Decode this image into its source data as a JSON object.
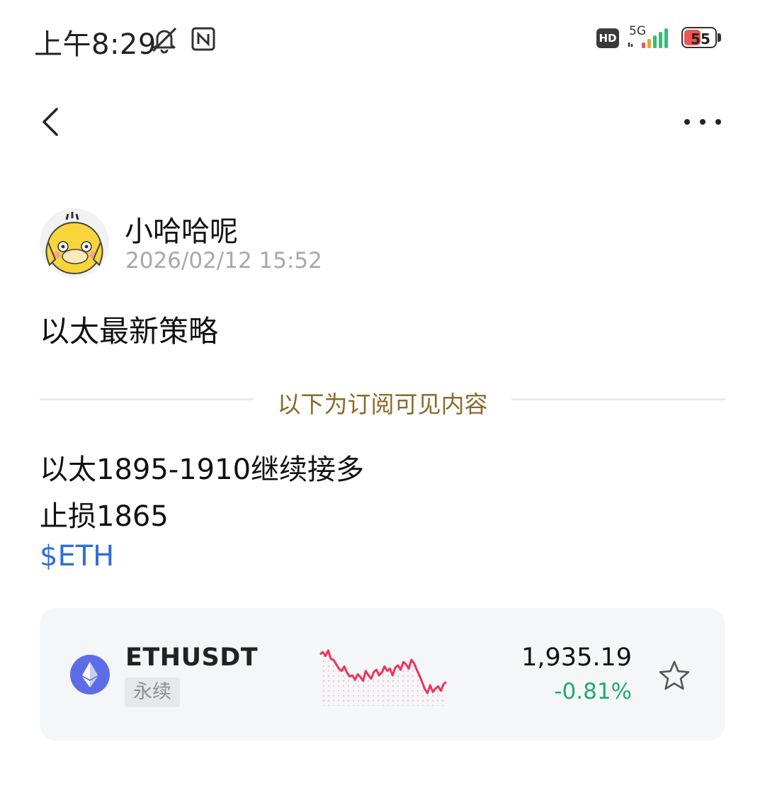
{
  "status_bar": {
    "time": "上午8:29",
    "hd": "HD",
    "network": "5G",
    "battery": "55",
    "battery_level": 0.55
  },
  "nav": {
    "back_icon": "chevron-left-icon",
    "more_icon": "more-horizontal-icon"
  },
  "author": {
    "name": "小哈哈呢",
    "time": "2026/02/12 15:52",
    "avatar_icon": "duck-avatar"
  },
  "post": {
    "title": "以太最新策略",
    "divider_text": "以下为订阅可见内容",
    "lines": [
      "以太1895-1910继续接多",
      "止损1865"
    ],
    "tag": "$ETH"
  },
  "ticker": {
    "symbol": "ETHUSDT",
    "contract_type": "永续",
    "price": "1,935.19",
    "change": "-0.81%",
    "change_color": "#23a96e",
    "spark_color": "#f0325a",
    "spark_values": [
      0.88,
      0.92,
      0.85,
      0.95,
      0.8,
      0.78,
      0.7,
      0.62,
      0.58,
      0.66,
      0.55,
      0.48,
      0.5,
      0.42,
      0.52,
      0.47,
      0.4,
      0.58,
      0.5,
      0.44,
      0.56,
      0.6,
      0.5,
      0.55,
      0.66,
      0.58,
      0.62,
      0.5,
      0.64,
      0.68,
      0.6,
      0.74,
      0.7,
      0.62,
      0.78,
      0.72,
      0.6,
      0.5,
      0.38,
      0.25,
      0.18,
      0.32,
      0.2,
      0.26,
      0.3,
      0.22,
      0.34,
      0.38
    ],
    "star_icon": "star-outline-icon",
    "logo_icon": "ethereum-icon"
  }
}
